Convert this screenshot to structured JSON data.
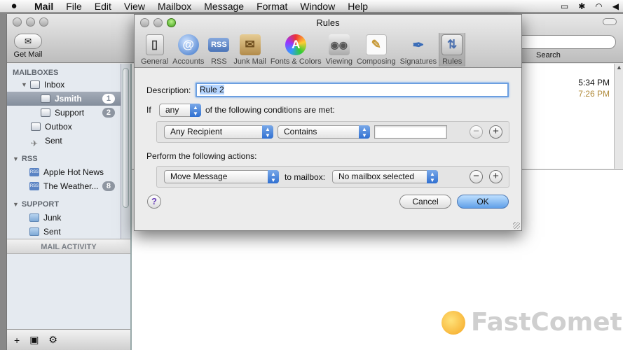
{
  "menubar": {
    "app": "Mail",
    "items": [
      "File",
      "Edit",
      "View",
      "Mailbox",
      "Message",
      "Format",
      "Window",
      "Help"
    ]
  },
  "toolbar": {
    "get_mail": "Get Mail",
    "search_label": "Search"
  },
  "sidebar": {
    "mailboxes_header": "MAILBOXES",
    "inbox": "Inbox",
    "jsmith": "Jsmith",
    "jsmith_count": "1",
    "support": "Support",
    "support_count": "2",
    "outbox": "Outbox",
    "sent": "Sent",
    "rss_header": "RSS",
    "apple_hot_news": "Apple Hot News",
    "weather": "The Weather...",
    "weather_count": "8",
    "support_header": "SUPPORT",
    "junk": "Junk",
    "sent2": "Sent",
    "mail_activity": "MAIL ACTIVITY"
  },
  "messages": {
    "time1": "5:34 PM",
    "time2": "7:26 PM"
  },
  "rules": {
    "title": "Rules",
    "prefs": [
      "General",
      "Accounts",
      "RSS",
      "Junk Mail",
      "Fonts & Colors",
      "Viewing",
      "Composing",
      "Signatures",
      "Rules"
    ],
    "description_label": "Description:",
    "description_value": "Rule 2",
    "if_label": "If",
    "match_value": "any",
    "conditions_text": "of the following conditions are met:",
    "condition_field": "Any Recipient",
    "condition_op": "Contains",
    "actions_label": "Perform the following actions:",
    "action": "Move Message",
    "to_mailbox_label": "to mailbox:",
    "mailbox_value": "No mailbox selected",
    "cancel": "Cancel",
    "ok": "OK"
  },
  "watermark": "FastComet",
  "colors": {
    "ok_button": "#5f9fe8",
    "focus_ring": "#6c9fe0",
    "selected_row": "#848e9c"
  }
}
